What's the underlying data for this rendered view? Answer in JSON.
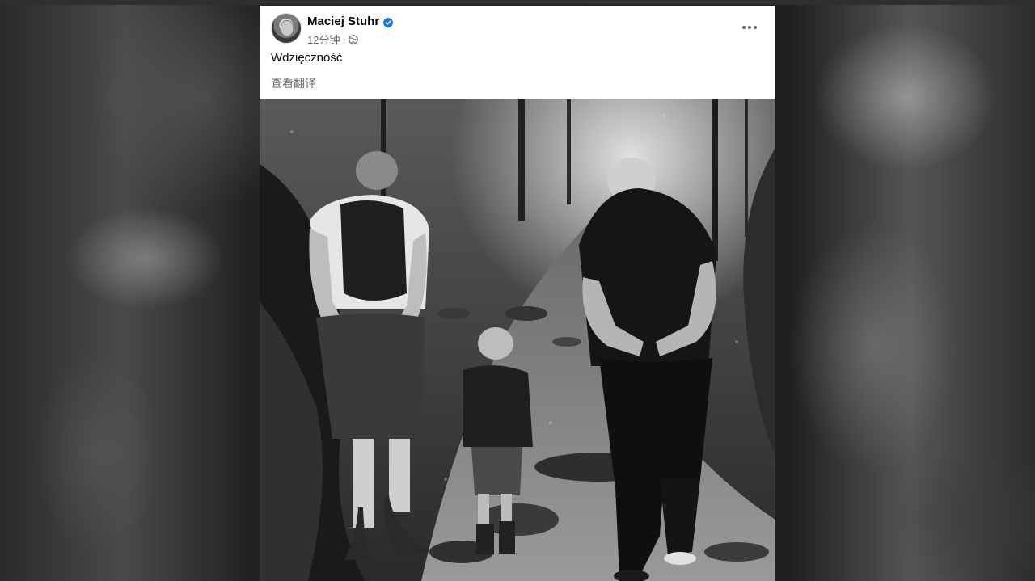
{
  "post": {
    "author_name": "Maciej Stuhr",
    "time": "12分钟",
    "separator": "·",
    "text": "Wdzięczność",
    "translate_label": "查看翻译"
  },
  "icons": {
    "verified": "verified-badge-icon",
    "audience": "globe-icon",
    "more": "more-options-icon"
  },
  "colors": {
    "verified_blue": "#1877f2",
    "secondary_text": "#65676b",
    "primary_text": "#050505"
  }
}
